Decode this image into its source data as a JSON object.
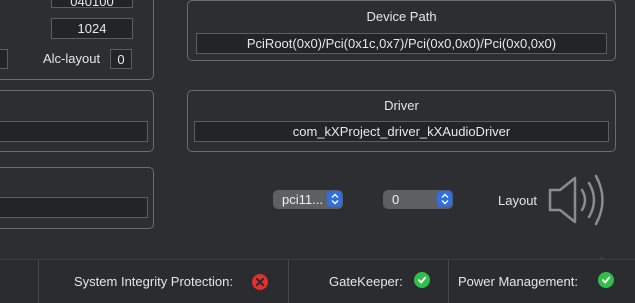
{
  "left_panel": {
    "top_value": "040100",
    "value_field": "1024",
    "alc_layout_label": "Alc-layout",
    "alc_layout_value": "0"
  },
  "device_path": {
    "title": "Device Path",
    "value": "PciRoot(0x0)/Pci(0x1c,0x7)/Pci(0x0,0x0)/Pci(0x0,0x0)"
  },
  "driver": {
    "title": "Driver",
    "value": "com_kXProject_driver_kXAudioDriver"
  },
  "controls": {
    "pci_popup": "pci11...",
    "layout_popup": "0",
    "layout_label": "Layout",
    "speaker_icon": "speaker-volume-icon"
  },
  "status": {
    "sip_label": "System Integrity Protection:",
    "sip_state": "error",
    "gatekeeper_label": "GateKeeper:",
    "gatekeeper_state": "ok",
    "power_label": "Power Management:",
    "power_state": "ok",
    "colors": {
      "ok": "#2fbf4a",
      "error": "#e0312b"
    }
  }
}
